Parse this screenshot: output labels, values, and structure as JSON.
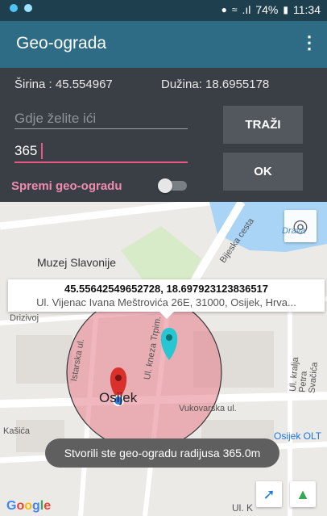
{
  "status_bar": {
    "battery": "74%",
    "time": "11:34",
    "signal": ".ıl"
  },
  "app_bar": {
    "title": "Geo-ograda",
    "menu_icon": "⋮"
  },
  "form": {
    "latitude_text": "Širina : 45.554967",
    "longitude_text": "Dužina: 18.6955178",
    "search_placeholder": "Gdje želite ići",
    "radius_value": "365",
    "search_button": "TRAŽI",
    "ok_button": "OK",
    "toggle_label": "Spremi geo-ogradu",
    "toggle_on": false
  },
  "map": {
    "place_label": "Muzej Slavonije",
    "info_title": "45.55642549652728, 18.697923123836517",
    "info_subtitle": "Ul. Vijenac Ivana Meštrovića 26E, 31000, Osijek, Hrva...",
    "street_labels": {
      "bijeska": "Bijeska cesta",
      "drava": "Drava",
      "istarska": "Istarska ul.",
      "kneza": "Ul. kneza Trpim.",
      "petra": "Ul. kralja Petra Svačića",
      "vukovarska": "Vukovarska ul.",
      "kasica": "Kašića",
      "strizivoj": "Drizivoj"
    },
    "city_label": "Osijek",
    "station_label": "Osijek OLT",
    "toast": "Stvorili ste geo-ogradu radijusa 365.0m",
    "google": "Google",
    "bottom_street": "Ul. K",
    "colors": {
      "circle": "#e57c8a",
      "marker_red": "#d9302c",
      "marker_cyan": "#27c6d0",
      "river": "#a9d4f5"
    }
  }
}
